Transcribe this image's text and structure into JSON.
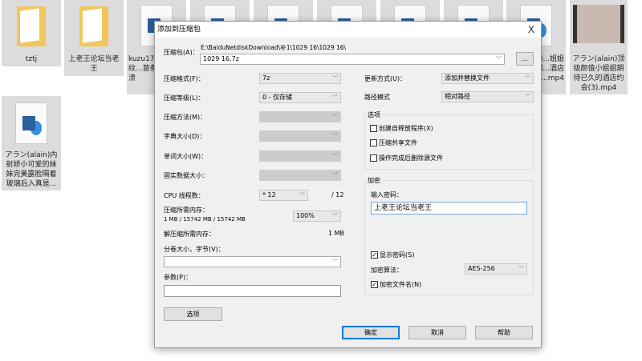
{
  "desktop": {
    "files": [
      {
        "name": "tztj",
        "icon": "folder-icon"
      },
      {
        "name": "上老王论坛当老王",
        "icon": "folder-icon"
      },
      {
        "name": "kuzu17...穿条纹...苗条女...崩溃",
        "icon": "video-file-icon"
      },
      {
        "name": "...ain)顶...姐姐期...酒店约...mp4",
        "icon": "video-file-icon"
      },
      {
        "name": "アラン(alain)顶级颜值小姐姐期待已久的酒店约会(3).mp4",
        "icon": "video-thumbnail"
      },
      {
        "name": "アラン(alain)内射娇小可爱的妹妹完美露脸隔着玻璃后入真是...",
        "icon": "video-file-icon"
      }
    ]
  },
  "dialog": {
    "title": "添加到压缩包",
    "close": "X",
    "archive_label": "压缩包(A)：",
    "archive_path": "E:\\BaiduNetdiskDownload\\补1\\1029 16\\1029 16\\",
    "archive_name": "1029 16.7z",
    "browse": "...",
    "left": {
      "format_label": "压缩格式(F)：",
      "format": "7z",
      "level_label": "压缩等级(L)：",
      "level": "0 - 仅存储",
      "method_label": "压缩方法(M)：",
      "dict_label": "字典大小(D)：",
      "word_label": "单词大小(W)：",
      "solid_label": "固实数据大小：",
      "cpu_label": "CPU 线程数：",
      "cpu": "* 12",
      "cpu_max": "/ 12",
      "mem_label": "压缩所需内存：",
      "mem_value": "1 MB / 15742 MB / 15742 MB",
      "mem_pct": "100%",
      "dmem_label": "解压缩所需内存：",
      "dmem_value": "1 MB",
      "volume_label": "分卷大小，字节(V)：",
      "volume": "",
      "params_label": "参数(P)：",
      "params": "",
      "options_button": "选项"
    },
    "right": {
      "update_label": "更新方式(U)：",
      "update": "添加并替换文件",
      "path_label": "路径模式",
      "path": "相对路径",
      "options_title": "选项",
      "options": [
        {
          "label": "创建自释放程序(X)",
          "checked": false
        },
        {
          "label": "压缩共享文件",
          "checked": false
        },
        {
          "label": "操作完成后删除源文件",
          "checked": false
        }
      ],
      "enc_title": "加密",
      "pwd_label": "输入密码：",
      "pwd": "上老王论坛当老王",
      "show_pwd": {
        "label": "显示密码(S)",
        "checked": true
      },
      "alg_label": "加密算法：",
      "alg": "AES-256",
      "enc_names": {
        "label": "加密文件名(N)",
        "checked": true
      }
    },
    "buttons": {
      "ok": "确定",
      "cancel": "取消",
      "help": "帮助"
    }
  }
}
